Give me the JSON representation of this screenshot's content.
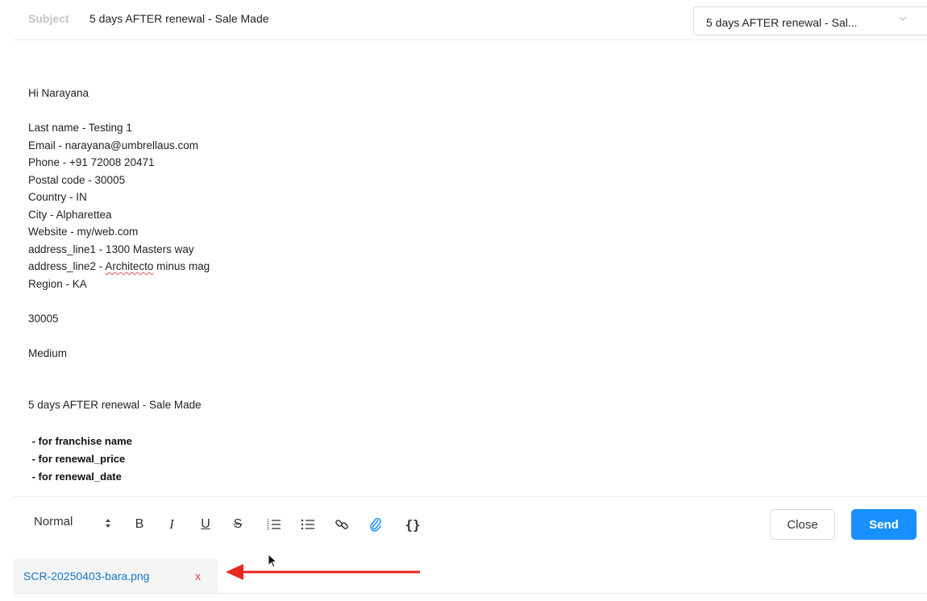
{
  "subject": {
    "label": "Subject",
    "value": "5 days AFTER renewal  - Sale Made"
  },
  "template_select": {
    "selected": "5 days AFTER renewal - Sal...",
    "icon": "chevron-down-icon"
  },
  "body": {
    "greeting": "Hi Narayana",
    "fields": [
      "Last name - Testing 1",
      "Email - narayana@umbrellaus.com",
      "Phone - +91 72008 20471",
      "Postal code - 30005",
      "Country - IN",
      "City - Alpharettea",
      "Website - my/web.com",
      "address_line1 - 1300 Masters way"
    ],
    "address_line2_prefix": "address_line2 - ",
    "address_line2_misspelled": "Architecto",
    "address_line2_suffix": " minus mag",
    "region": "Region - KA",
    "postal": "30005",
    "priority": "Medium",
    "template_line": "5 days AFTER renewal - Sale Made",
    "bold_lines": [
      " - for franchise name",
      " - for renewal_price",
      " - for renewal_date"
    ]
  },
  "toolbar": {
    "format_value": "Normal",
    "format_icon": "updown-arrows-icon",
    "bold_label": "B",
    "italic_label": "I",
    "underline_label": "U",
    "strike_label": "S",
    "code_label": "{}",
    "icons": [
      "bold-icon",
      "italic-icon",
      "underline-icon",
      "strikethrough-icon",
      "ordered-list-icon",
      "bullet-list-icon",
      "link-icon",
      "attach-icon",
      "code-braces-icon"
    ]
  },
  "actions": {
    "close_label": "Close",
    "send_label": "Send"
  },
  "attachment": {
    "filename": "SCR-20250403-bara.png",
    "remove_label": "x"
  },
  "colors": {
    "accent": "#1890ff",
    "link": "#1677c8",
    "remove": "#e04040",
    "arrow": "#e8281e"
  }
}
